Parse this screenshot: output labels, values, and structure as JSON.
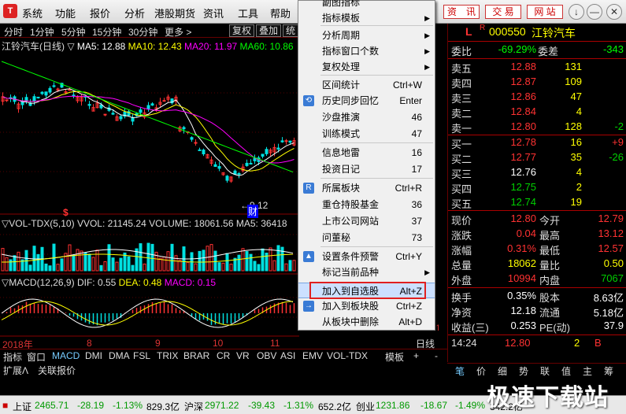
{
  "menubar": {
    "items": [
      "系统",
      "功能",
      "报价",
      "分析",
      "港股期货",
      "资讯",
      "工具",
      "帮助"
    ],
    "quick_buttons": [
      "资　讯",
      "交 易",
      "网 站"
    ],
    "window_controls": [
      "↓",
      "—",
      "□",
      "✕"
    ]
  },
  "periods": [
    "分时",
    "1分钟",
    "5分钟",
    "15分钟",
    "30分钟",
    "更多 >"
  ],
  "chart_buttons": [
    "复权",
    "叠加",
    "统"
  ],
  "kline_legend": {
    "title": "江铃汽车(日线)",
    "ma5": "MA5: 12.88",
    "ma10": "MA10: 12.43",
    "ma20": "MA20: 11.97",
    "ma60": "MA60: 10.86"
  },
  "price_annotation": "9.12",
  "finance_marker": "财",
  "vol_legend": {
    "name": "VOL-TDX(5,10)",
    "vvol": "VVOL: 21145.24",
    "volume": "VOLUME: 18061.56",
    "ma5": "MA5: 36418"
  },
  "macd_legend": {
    "name": "MACD(12,26,9)",
    "dif": "DIF: 0.55",
    "dea": "DEA: 0.48",
    "macd": "MACD: 0.15"
  },
  "time_axis": [
    "2018年",
    "8",
    "9",
    "10",
    "11",
    "1"
  ],
  "popup_menu": [
    {
      "label": "副图指标",
      "shortcut": "",
      "arrow": false,
      "icon": ""
    },
    {
      "label": "指标模板",
      "shortcut": "",
      "arrow": true,
      "icon": ""
    },
    {
      "label": "分析周期",
      "shortcut": "",
      "arrow": true,
      "icon": ""
    },
    {
      "label": "指标窗口个数",
      "shortcut": "",
      "arrow": true,
      "icon": ""
    },
    {
      "label": "复权处理",
      "shortcut": "",
      "arrow": true,
      "icon": ""
    },
    {
      "label": "区间统计",
      "shortcut": "Ctrl+W",
      "arrow": false,
      "icon": ""
    },
    {
      "label": "历史同步回忆",
      "shortcut": "Enter",
      "arrow": false,
      "icon": "history-icon"
    },
    {
      "label": "沙盘推演",
      "shortcut": "46",
      "arrow": false,
      "icon": ""
    },
    {
      "label": "训练模式",
      "shortcut": "47",
      "arrow": false,
      "icon": ""
    },
    {
      "label": "信息地雷",
      "shortcut": "16",
      "arrow": false,
      "icon": ""
    },
    {
      "label": "投资日记",
      "shortcut": "17",
      "arrow": false,
      "icon": ""
    },
    {
      "label": "所属板块",
      "shortcut": "Ctrl+R",
      "arrow": false,
      "icon": "sector-icon"
    },
    {
      "label": "重仓持股基金",
      "shortcut": "36",
      "arrow": false,
      "icon": ""
    },
    {
      "label": "上市公司网站",
      "shortcut": "37",
      "arrow": false,
      "icon": ""
    },
    {
      "label": "问董秘",
      "shortcut": "73",
      "arrow": false,
      "icon": ""
    },
    {
      "label": "设置条件预警",
      "shortcut": "Ctrl+Y",
      "arrow": false,
      "icon": "alert-icon"
    },
    {
      "label": "标记当前品种",
      "shortcut": "",
      "arrow": true,
      "icon": ""
    },
    {
      "label": "加入到自选股",
      "shortcut": "Alt+Z",
      "arrow": false,
      "icon": ""
    },
    {
      "label": "加入到板块股",
      "shortcut": "Ctrl+Z",
      "arrow": false,
      "icon": "add-board-icon"
    },
    {
      "label": "从板块中删除",
      "shortcut": "Alt+D",
      "arrow": false,
      "icon": ""
    }
  ],
  "quote": {
    "tag": "L",
    "r_mark": "R",
    "code": "000550",
    "name": "江铃汽车",
    "weibi_label": "委比",
    "weibi": "-69.29%",
    "weicha_label": "委差",
    "weicha": "-343",
    "asks": [
      {
        "label": "卖五",
        "price": "12.88",
        "vol": "131",
        "chg": ""
      },
      {
        "label": "卖四",
        "price": "12.87",
        "vol": "109",
        "chg": ""
      },
      {
        "label": "卖三",
        "price": "12.86",
        "vol": "47",
        "chg": ""
      },
      {
        "label": "卖二",
        "price": "12.84",
        "vol": "4",
        "chg": ""
      },
      {
        "label": "卖一",
        "price": "12.80",
        "vol": "128",
        "chg": "-2"
      }
    ],
    "bids": [
      {
        "label": "买一",
        "price": "12.78",
        "vol": "16",
        "chg": "+9"
      },
      {
        "label": "买二",
        "price": "12.77",
        "vol": "35",
        "chg": "-26"
      },
      {
        "label": "买三",
        "price": "12.76",
        "vol": "4",
        "chg": ""
      },
      {
        "label": "买四",
        "price": "12.75",
        "vol": "2",
        "chg": ""
      },
      {
        "label": "买五",
        "price": "12.74",
        "vol": "19",
        "chg": ""
      }
    ],
    "stats": [
      {
        "l1": "现价",
        "v1": "12.80",
        "l2": "今开",
        "v2": "12.79"
      },
      {
        "l1": "涨跌",
        "v1": "0.04",
        "l2": "最高",
        "v2": "13.12"
      },
      {
        "l1": "涨幅",
        "v1": "0.31%",
        "l2": "最低",
        "v2": "12.57"
      },
      {
        "l1": "总量",
        "v1": "18062",
        "l2": "量比",
        "v2": "0.50"
      },
      {
        "l1": "外盘",
        "v1": "10994",
        "l2": "内盘",
        "v2": "7067"
      }
    ],
    "stats2": [
      {
        "l1": "换手",
        "v1": "0.35%",
        "l2": "股本",
        "v2": "8.63亿"
      },
      {
        "l1": "净资",
        "v1": "12.18",
        "l2": "流通",
        "v2": "5.18亿"
      },
      {
        "l1": "收益(三)",
        "v1": "0.253",
        "l2": "PE(动)",
        "v2": "37.9"
      }
    ],
    "tick": {
      "time": "14:24",
      "price": "12.80",
      "vol": "2",
      "side": "B"
    }
  },
  "indicator_tabs": [
    "指标",
    "窗口",
    "MACD",
    "DMI",
    "DMA",
    "FSL",
    "TRIX",
    "BRAR",
    "CR",
    "VR",
    "OBV",
    "ASI",
    "EMV",
    "VOL-TDX",
    "模板",
    "+",
    "-"
  ],
  "period_label": "日线",
  "sub_tabs": [
    "扩展Λ",
    "关联报价"
  ],
  "quote_tabs": [
    "笔",
    "价",
    "细",
    "势",
    "联",
    "值",
    "主",
    "筹"
  ],
  "status": {
    "sh_label": "上证",
    "sh_val": "2465.71",
    "sh_chg": "-28.19",
    "sh_pct": "-1.13%",
    "sh_amt": "829.3亿",
    "hs_label": "沪深",
    "hs_val": "2971.22",
    "hs_chg": "-39.43",
    "hs_pct": "-1.31%",
    "hs_amt": "652.2亿",
    "cy_label": "创业",
    "cy_val": "1231.86",
    "cy_chg": "-18.67",
    "cy_pct": "-1.49%",
    "cy_amt": "342.2亿"
  },
  "watermark": "极速下载站",
  "colors": {
    "up": "#ff3232",
    "down": "#00d000",
    "ma5": "#ffffff",
    "ma10": "#ffff00",
    "ma20": "#ff00ff",
    "ma60": "#00ff00"
  }
}
